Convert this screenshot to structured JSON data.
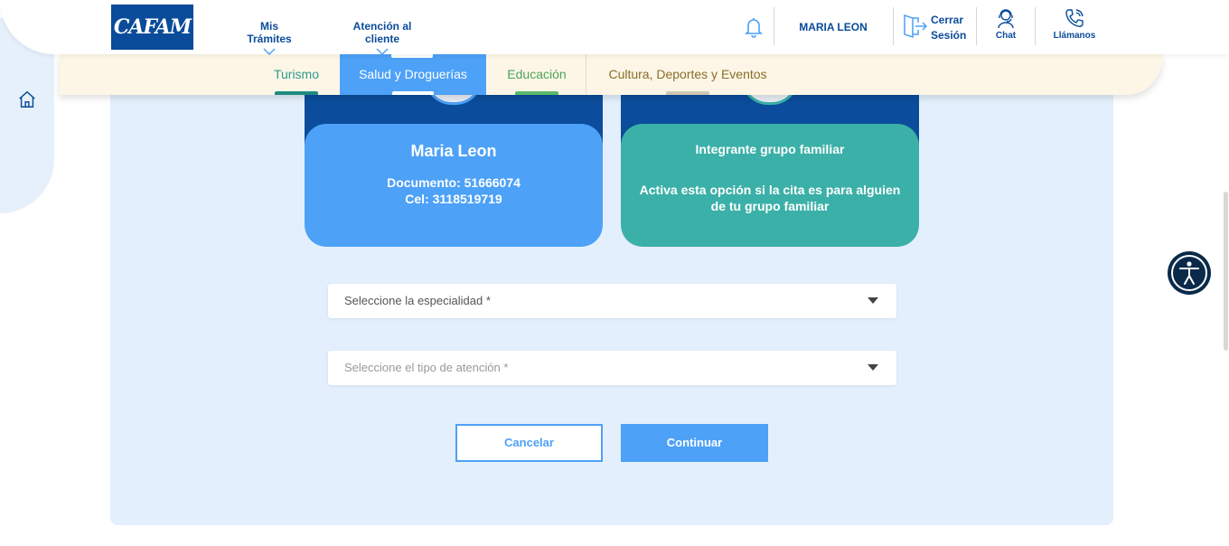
{
  "brand": {
    "logo_text": "CAFAM",
    "primary_color": "#0a4b9a",
    "accent_blue": "#4da1f7",
    "teal": "#3bb0a8"
  },
  "header": {
    "nav": [
      {
        "label": "Mis Trámites"
      },
      {
        "label": "Atención al cliente"
      }
    ],
    "user_name": "MARIA LEON",
    "logout_label_1": "Cerrar",
    "logout_label_2": "Sesión",
    "chat_label": "Chat",
    "call_label": "Llámanos",
    "icons": [
      "bell-icon",
      "logout-icon",
      "chat-agent-icon",
      "phone-icon",
      "home-icon",
      "accessibility-icon"
    ]
  },
  "tabs": [
    {
      "label": "Turismo",
      "color": "#2f9a91",
      "active": false
    },
    {
      "label": "Salud y Droguerías",
      "color": "#ffffff",
      "active": true
    },
    {
      "label": "Educación",
      "color": "#4aa45a",
      "active": false
    },
    {
      "label": "Cultura, Deportes y Eventos",
      "color": "#8a6d2a",
      "active": false
    }
  ],
  "cards": {
    "self": {
      "name": "Maria Leon",
      "document": "Documento: 51666074",
      "cel": "Cel: 3118519719"
    },
    "family": {
      "title": "Integrante grupo familiar",
      "line1": "Activa esta opción si la cita es para alguien",
      "line2": "de tu grupo familiar"
    }
  },
  "form": {
    "specialty_placeholder": "Seleccione la especialidad *",
    "attention_type_placeholder": "Seleccione el tipo de atención *"
  },
  "actions": {
    "cancel_label": "Cancelar",
    "continue_label": "Continuar"
  }
}
